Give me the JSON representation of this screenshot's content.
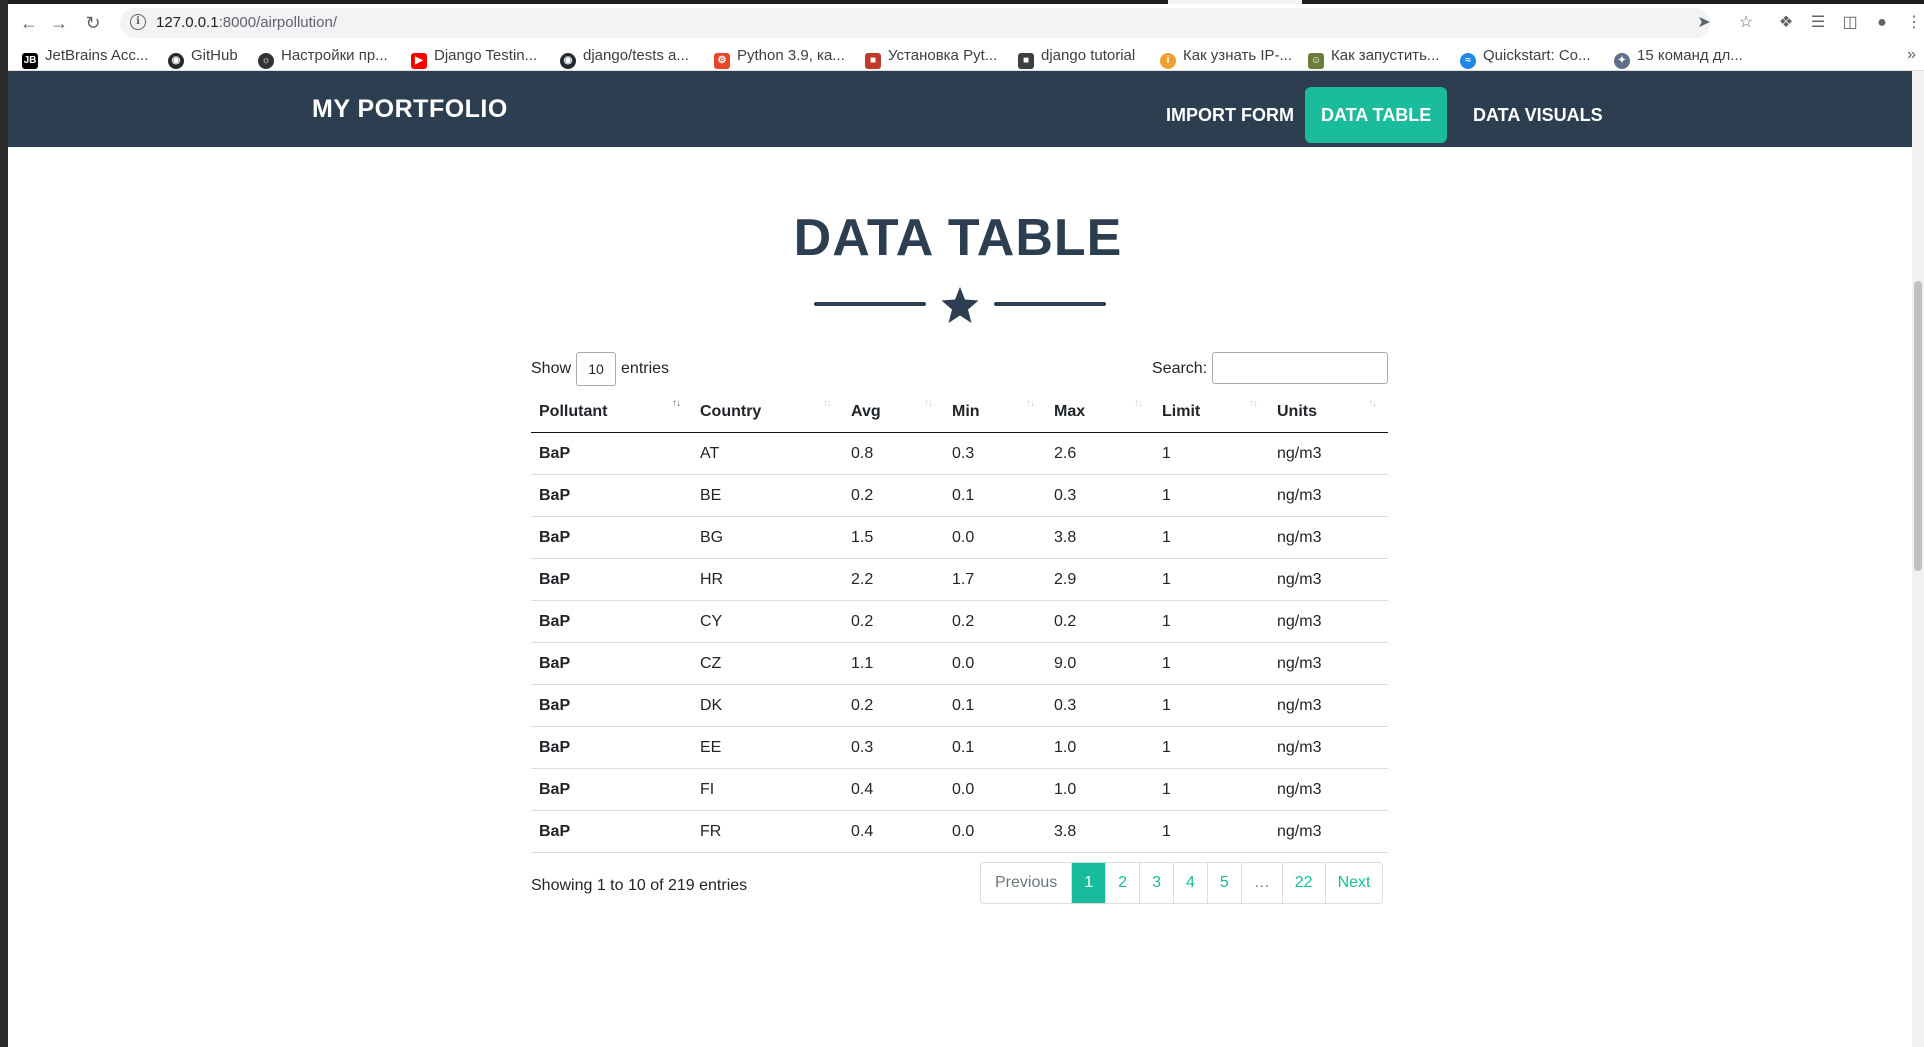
{
  "browser": {
    "url_host": "127.0.0.1",
    "url_path": ":8000/airpollution/",
    "bookmarks": [
      {
        "label": "JetBrains Acc...",
        "icon": "jetbrains-icon",
        "color": "#000000"
      },
      {
        "label": "GitHub",
        "icon": "github-icon",
        "color": "#24292e"
      },
      {
        "label": "Настройки пр...",
        "icon": "globe-icon",
        "color": "#333333"
      },
      {
        "label": "Django Testin...",
        "icon": "youtube-icon",
        "color": "#ff0000"
      },
      {
        "label": "django/tests a...",
        "icon": "github-icon",
        "color": "#24292e"
      },
      {
        "label": "Python 3.9, ка...",
        "icon": "gear-red-icon",
        "color": "#e8452c"
      },
      {
        "label": "Установка Pyt...",
        "icon": "app-icon",
        "color": "#c0392b"
      },
      {
        "label": "django tutorial",
        "icon": "folder-icon",
        "color": "#3c4043"
      },
      {
        "label": "Как узнать IP-...",
        "icon": "circle-ip-icon",
        "color": "#f0a030"
      },
      {
        "label": "Как запустить...",
        "icon": "robot-icon",
        "color": "#6d7c3c"
      },
      {
        "label": "Quickstart: Co...",
        "icon": "swirl-icon",
        "color": "#1e88e5"
      },
      {
        "label": "15 команд дл...",
        "icon": "wing-icon",
        "color": "#5f6f8a"
      }
    ]
  },
  "navbar": {
    "brand": "MY PORTFOLIO",
    "items": [
      {
        "label": "IMPORT FORM",
        "active": false
      },
      {
        "label": "DATA TABLE",
        "active": true
      },
      {
        "label": "DATA VISUALS",
        "active": false
      }
    ]
  },
  "page": {
    "title": "DATA TABLE"
  },
  "table": {
    "show_label": "Show",
    "entries_label": "entries",
    "page_length": "10",
    "search_label": "Search:",
    "search_value": "",
    "columns": [
      "Pollutant",
      "Country",
      "Avg",
      "Min",
      "Max",
      "Limit",
      "Units"
    ],
    "rows": [
      [
        "BaP",
        "AT",
        "0.8",
        "0.3",
        "2.6",
        "1",
        "ng/m3"
      ],
      [
        "BaP",
        "BE",
        "0.2",
        "0.1",
        "0.3",
        "1",
        "ng/m3"
      ],
      [
        "BaP",
        "BG",
        "1.5",
        "0.0",
        "3.8",
        "1",
        "ng/m3"
      ],
      [
        "BaP",
        "HR",
        "2.2",
        "1.7",
        "2.9",
        "1",
        "ng/m3"
      ],
      [
        "BaP",
        "CY",
        "0.2",
        "0.2",
        "0.2",
        "1",
        "ng/m3"
      ],
      [
        "BaP",
        "CZ",
        "1.1",
        "0.0",
        "9.0",
        "1",
        "ng/m3"
      ],
      [
        "BaP",
        "DK",
        "0.2",
        "0.1",
        "0.3",
        "1",
        "ng/m3"
      ],
      [
        "BaP",
        "EE",
        "0.3",
        "0.1",
        "1.0",
        "1",
        "ng/m3"
      ],
      [
        "BaP",
        "FI",
        "0.4",
        "0.0",
        "1.0",
        "1",
        "ng/m3"
      ],
      [
        "BaP",
        "FR",
        "0.4",
        "0.0",
        "3.8",
        "1",
        "ng/m3"
      ]
    ],
    "info": "Showing 1 to 10 of 219 entries",
    "pagination": [
      "Previous",
      "1",
      "2",
      "3",
      "4",
      "5",
      "…",
      "22",
      "Next"
    ],
    "current_page": "1"
  },
  "colors": {
    "navbar": "#2c3e50",
    "accent": "#1abc9c",
    "title": "#2c3e50"
  }
}
